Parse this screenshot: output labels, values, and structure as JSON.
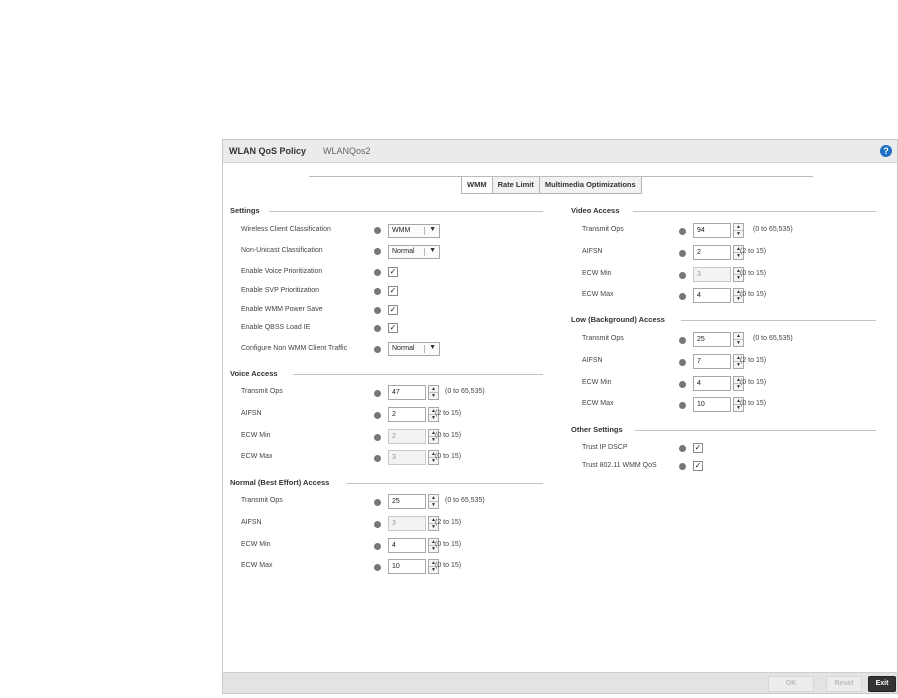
{
  "header": {
    "title": "WLAN QoS Policy",
    "subtitle": "WLANQos2",
    "help_icon": "help-icon"
  },
  "tabs": [
    {
      "label": "WMM",
      "active": true
    },
    {
      "label": "Rate Limit",
      "active": false
    },
    {
      "label": "Multimedia Optimizations",
      "active": false
    }
  ],
  "settings": {
    "title": "Settings",
    "wireless_client_classification": {
      "label": "Wireless Client Classification",
      "value": "WMM"
    },
    "non_unicast_classification": {
      "label": "Non-Unicast Classification",
      "value": "Normal"
    },
    "enable_voice_prioritization": {
      "label": "Enable Voice Prioritization",
      "checked": true
    },
    "enable_svp_prioritization": {
      "label": "Enable SVP Prioritization",
      "checked": true
    },
    "enable_wmm_power_save": {
      "label": "Enable WMM Power Save",
      "checked": true
    },
    "enable_qbss_load_ie": {
      "label": "Enable QBSS Load IE",
      "checked": true
    },
    "configure_non_wmm": {
      "label": "Configure Non WMM Client Traffic",
      "value": "Normal"
    }
  },
  "voice_access": {
    "title": "Voice Access",
    "transmit_ops": {
      "label": "Transmit Ops",
      "value": "47",
      "range": "(0 to 65,535)"
    },
    "aifsn": {
      "label": "AIFSN",
      "value": "2",
      "range": "(2 to 15)"
    },
    "ecw_min": {
      "label": "ECW Min",
      "value": "2",
      "range": "(0 to 15)"
    },
    "ecw_max": {
      "label": "ECW Max",
      "value": "3",
      "range": "(0 to 15)"
    }
  },
  "normal_access": {
    "title": "Normal (Best Effort) Access",
    "transmit_ops": {
      "label": "Transmit Ops",
      "value": "25",
      "range": "(0 to 65,535)"
    },
    "aifsn": {
      "label": "AIFSN",
      "value": "3",
      "range": "(2 to 15)"
    },
    "ecw_min": {
      "label": "ECW Min",
      "value": "4",
      "range": "(0 to 15)"
    },
    "ecw_max": {
      "label": "ECW Max",
      "value": "10",
      "range": "(0 to 15)"
    }
  },
  "video_access": {
    "title": "Video Access",
    "transmit_ops": {
      "label": "Transmit Ops",
      "value": "94",
      "range": "(0 to 65,535)"
    },
    "aifsn": {
      "label": "AIFSN",
      "value": "2",
      "range": "(2 to 15)"
    },
    "ecw_min": {
      "label": "ECW Min",
      "value": "3",
      "range": "(0 to 15)"
    },
    "ecw_max": {
      "label": "ECW Max",
      "value": "4",
      "range": "(0 to 15)"
    }
  },
  "low_access": {
    "title": "Low (Background) Access",
    "transmit_ops": {
      "label": "Transmit Ops",
      "value": "25",
      "range": "(0 to 65,535)"
    },
    "aifsn": {
      "label": "AIFSN",
      "value": "7",
      "range": "(2 to 15)"
    },
    "ecw_min": {
      "label": "ECW Min",
      "value": "4",
      "range": "(0 to 15)"
    },
    "ecw_max": {
      "label": "ECW Max",
      "value": "10",
      "range": "(0 to 15)"
    }
  },
  "other_settings": {
    "title": "Other Settings",
    "trust_ip_dscp": {
      "label": "Trust IP DSCP",
      "checked": true
    },
    "trust_wmm_qos": {
      "label": "Trust 802.11 WMM QoS",
      "checked": true
    }
  },
  "footer": {
    "ok_label": "OK",
    "reset_label": "Reset",
    "exit_label": "Exit"
  },
  "glyphs": {
    "check": "✓",
    "dropdown_arrow": "▼",
    "spin_up": "▲",
    "spin_down": "▼"
  },
  "colors": {
    "help_icon": "#1f6fc5",
    "exit_button": "#333333",
    "header_bg": "#ebebeb"
  }
}
